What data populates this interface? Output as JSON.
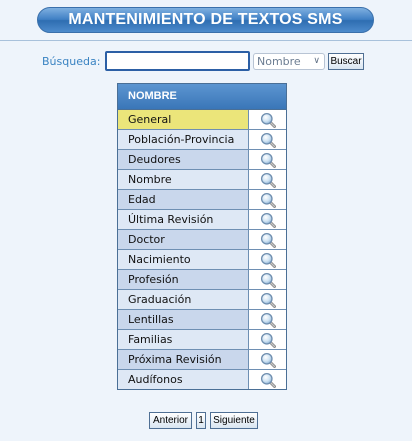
{
  "header": {
    "title": "MANTENIMIENTO DE TEXTOS SMS"
  },
  "search": {
    "label": "Búsqueda:",
    "value": "",
    "field_selected": "Nombre",
    "button_label": "Buscar"
  },
  "table": {
    "column_header": "NOMBRE",
    "selected_index": 0,
    "rows": [
      {
        "name": "General"
      },
      {
        "name": "Población-Provincia"
      },
      {
        "name": "Deudores"
      },
      {
        "name": "Nombre"
      },
      {
        "name": "Edad"
      },
      {
        "name": "Última Revisión"
      },
      {
        "name": "Doctor"
      },
      {
        "name": "Nacimiento"
      },
      {
        "name": "Profesión"
      },
      {
        "name": "Graduación"
      },
      {
        "name": "Lentillas"
      },
      {
        "name": "Familias"
      },
      {
        "name": "Próxima Revisión"
      },
      {
        "name": "Audífonos"
      }
    ],
    "row_icon": "magnifier-icon"
  },
  "pager": {
    "prev_label": "Anterior",
    "page_label": "1",
    "next_label": "Siguiente"
  },
  "colors": {
    "title_bar": "#3f7fc4",
    "selected_row": "#ebe57a",
    "row_odd": "#c9d7ec",
    "row_even": "#dee8f5",
    "label_blue": "#3a83c2"
  }
}
